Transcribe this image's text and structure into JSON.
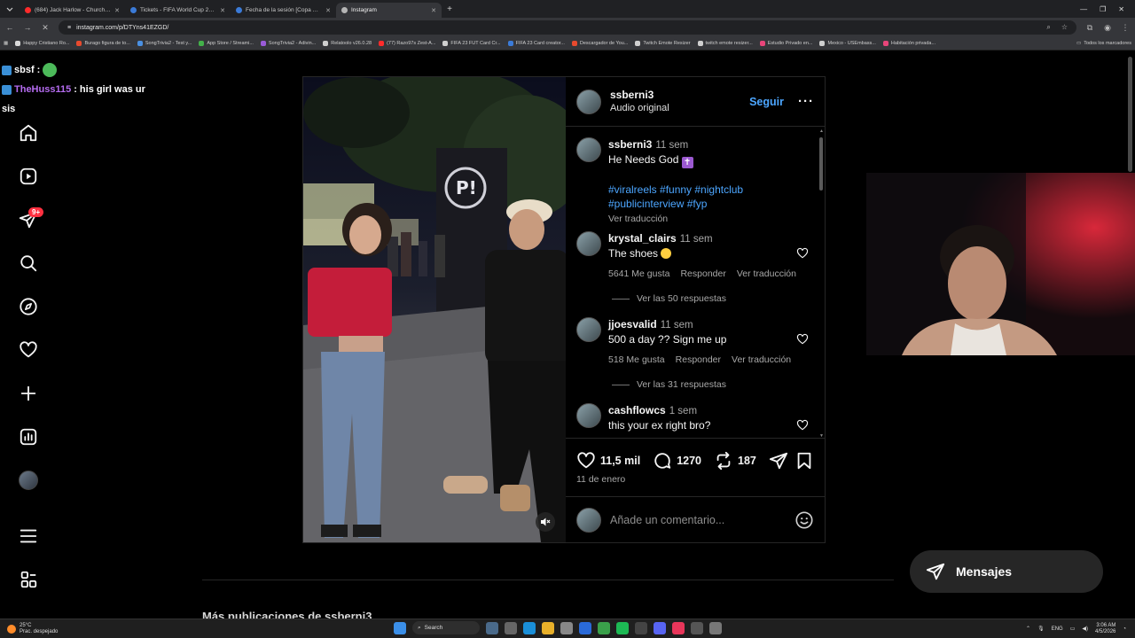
{
  "browser": {
    "tabs": [
      {
        "title": "(684) Jack Harlow - Churchill D",
        "color": "#ff2b2b",
        "active": false
      },
      {
        "title": "Tickets - FIFA World Cup 2026™",
        "color": "#3b7bd8",
        "active": false
      },
      {
        "title": "Fecha de la sesión [Copa Mund",
        "color": "#3b7bd8",
        "active": false
      },
      {
        "title": "Instagram",
        "color": "#b5b5b5",
        "active": true
      }
    ],
    "url": "instagram.com/p/DTYns41EZGD/",
    "bookmarks": [
      {
        "label": "Happy Cristiano Ro...",
        "color": "#d9d9d9"
      },
      {
        "label": "Burago figura de to...",
        "color": "#e84a2e"
      },
      {
        "label": "SongTrivia2 - Test y...",
        "color": "#4a90e2"
      },
      {
        "label": "App Store / Streami...",
        "color": "#43b04a"
      },
      {
        "label": "SongTrivia2 - Adivin...",
        "color": "#9a5bd8"
      },
      {
        "label": "Relatoolo v26.0.28",
        "color": "#cfcfcf"
      },
      {
        "label": "(77) Razo97s Zest-A...",
        "color": "#ff2b2b"
      },
      {
        "label": "FIFA 23 FUT Card Cr...",
        "color": "#cfcfcf"
      },
      {
        "label": "FIFA 23 Card creator...",
        "color": "#3b7bd8"
      },
      {
        "label": "Descargador de You...",
        "color": "#e84a2e"
      },
      {
        "label": "Twitch Emote Resizer",
        "color": "#cfcfcf"
      },
      {
        "label": "twitch emote resizer...",
        "color": "#cfcfcf"
      },
      {
        "label": "Estudio Privado en...",
        "color": "#e8457a"
      },
      {
        "label": "Mexico - USEmbass...",
        "color": "#cfcfcf"
      },
      {
        "label": "Habitación privada...",
        "color": "#e8457a"
      }
    ],
    "all_bookmarks": "Todos los marcadores"
  },
  "chat": {
    "line1_user": "sbsf :",
    "line2_user": "TheHuss115",
    "line2_text": ": his girl was ur",
    "line2_wrap": "sis"
  },
  "sidebar": {
    "notification_count": "9+"
  },
  "post": {
    "username": "ssberni3",
    "audio": "Audio original",
    "follow": "Seguir",
    "caption": {
      "user": "ssberni3",
      "time": "11 sem",
      "text": "He Needs God",
      "hashtags1": "#viralreels #funny #nightclub",
      "hashtags2": "#publicinterview #fyp",
      "translate": "Ver traducción"
    },
    "comments": [
      {
        "user": "krystal_clairs",
        "time": "11 sem",
        "text": "The shoes",
        "likes": "5641 Me gusta",
        "reply": "Responder",
        "translate": "Ver traducción",
        "replies": "Ver las 50 respuestas"
      },
      {
        "user": "jjoesvalid",
        "time": "11 sem",
        "text": "500 a day ?? Sign me up",
        "likes": "518 Me gusta",
        "reply": "Responder",
        "translate": "Ver traducción",
        "replies": "Ver las 31 respuestas"
      },
      {
        "user": "cashflowcs",
        "time": "1 sem",
        "text": "this your ex right bro?"
      }
    ],
    "likes": "11,5 mil",
    "comment_count": "1270",
    "reposts": "187",
    "date": "11 de enero",
    "add_comment_placeholder": "Añade un comentario..."
  },
  "messages_label": "Mensajes",
  "more_from": "Más publicaciones de ssberni3",
  "taskbar": {
    "temp": "25°C",
    "weather": "Prac. despejado",
    "search": "Search",
    "lang": "ENG",
    "time": "3:06 AM",
    "date": "4/5/2026"
  }
}
